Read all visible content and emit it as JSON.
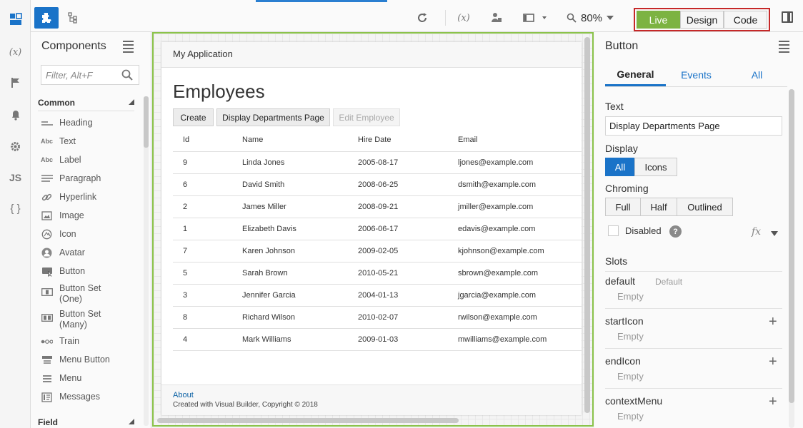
{
  "rail": {
    "items": [
      {
        "icon": "components-icon"
      },
      {
        "icon": "variables-icon",
        "label": "(x)"
      },
      {
        "icon": "flag-icon"
      },
      {
        "icon": "bell-icon"
      },
      {
        "icon": "gear-icon"
      },
      {
        "icon": "js-icon",
        "label": "JS"
      },
      {
        "icon": "braces-icon",
        "label": "{ }"
      }
    ]
  },
  "toolbar": {
    "zoom": "80%",
    "modes": [
      "Live",
      "Design",
      "Code"
    ],
    "active_mode": "Live",
    "mode_live_color": "#7cb342"
  },
  "palette": {
    "title": "Components",
    "search_placeholder": "Filter, Alt+F",
    "section_common": "Common",
    "section_field": "Field",
    "items": [
      {
        "label": "Heading",
        "icon": "heading-icon"
      },
      {
        "label": "Text",
        "icon": "text-icon",
        "glyph": "Abc"
      },
      {
        "label": "Label",
        "icon": "label-icon",
        "glyph": "Abc"
      },
      {
        "label": "Paragraph",
        "icon": "paragraph-icon"
      },
      {
        "label": "Hyperlink",
        "icon": "link-icon"
      },
      {
        "label": "Image",
        "icon": "image-icon"
      },
      {
        "label": "Icon",
        "icon": "icon-icon"
      },
      {
        "label": "Avatar",
        "icon": "avatar-icon"
      },
      {
        "label": "Button",
        "icon": "button-icon"
      },
      {
        "label": "Button Set\n(One)",
        "icon": "button-set-one-icon"
      },
      {
        "label": "Button Set\n(Many)",
        "icon": "button-set-many-icon"
      },
      {
        "label": "Train",
        "icon": "train-icon"
      },
      {
        "label": "Menu Button",
        "icon": "menu-button-icon"
      },
      {
        "label": "Menu",
        "icon": "menu-icon"
      },
      {
        "label": "Messages",
        "icon": "messages-icon"
      }
    ]
  },
  "canvas": {
    "app_title": "My Application",
    "page_title": "Employees",
    "buttons": {
      "create": "Create",
      "display_departments": "Display Departments Page",
      "edit_employee": "Edit Employee"
    },
    "table": {
      "headers": [
        "Id",
        "Name",
        "Hire Date",
        "Email"
      ],
      "rows": [
        [
          "9",
          "Linda Jones",
          "2005-08-17",
          "ljones@example.com"
        ],
        [
          "6",
          "David Smith",
          "2008-06-25",
          "dsmith@example.com"
        ],
        [
          "2",
          "James Miller",
          "2008-09-21",
          "jmiller@example.com"
        ],
        [
          "1",
          "Elizabeth Davis",
          "2006-06-17",
          "edavis@example.com"
        ],
        [
          "7",
          "Karen Johnson",
          "2009-02-05",
          "kjohnson@example.com"
        ],
        [
          "5",
          "Sarah Brown",
          "2010-05-21",
          "sbrown@example.com"
        ],
        [
          "3",
          "Jennifer Garcia",
          "2004-01-13",
          "jgarcia@example.com"
        ],
        [
          "8",
          "Richard Wilson",
          "2010-02-07",
          "rwilson@example.com"
        ],
        [
          "4",
          "Mark Williams",
          "2009-01-03",
          "mwilliams@example.com"
        ]
      ]
    },
    "footer": {
      "about": "About",
      "copyright": "Created with Visual Builder, Copyright © 2018"
    }
  },
  "properties": {
    "title": "Button",
    "tabs": [
      "General",
      "Events",
      "All"
    ],
    "active_tab": "General",
    "text_label": "Text",
    "text_value": "Display Departments Page",
    "display_label": "Display",
    "display_options": [
      "All",
      "Icons"
    ],
    "display_selected": "All",
    "chroming_label": "Chroming",
    "chroming_options": [
      "Full",
      "Half",
      "Outlined"
    ],
    "disabled_label": "Disabled",
    "help": "?",
    "fx": "fx",
    "slots_label": "Slots",
    "slots": [
      {
        "name": "default",
        "tag": "Default",
        "value": "Empty"
      },
      {
        "name": "startIcon",
        "value": "Empty"
      },
      {
        "name": "endIcon",
        "value": "Empty"
      },
      {
        "name": "contextMenu",
        "value": "Empty"
      }
    ]
  }
}
